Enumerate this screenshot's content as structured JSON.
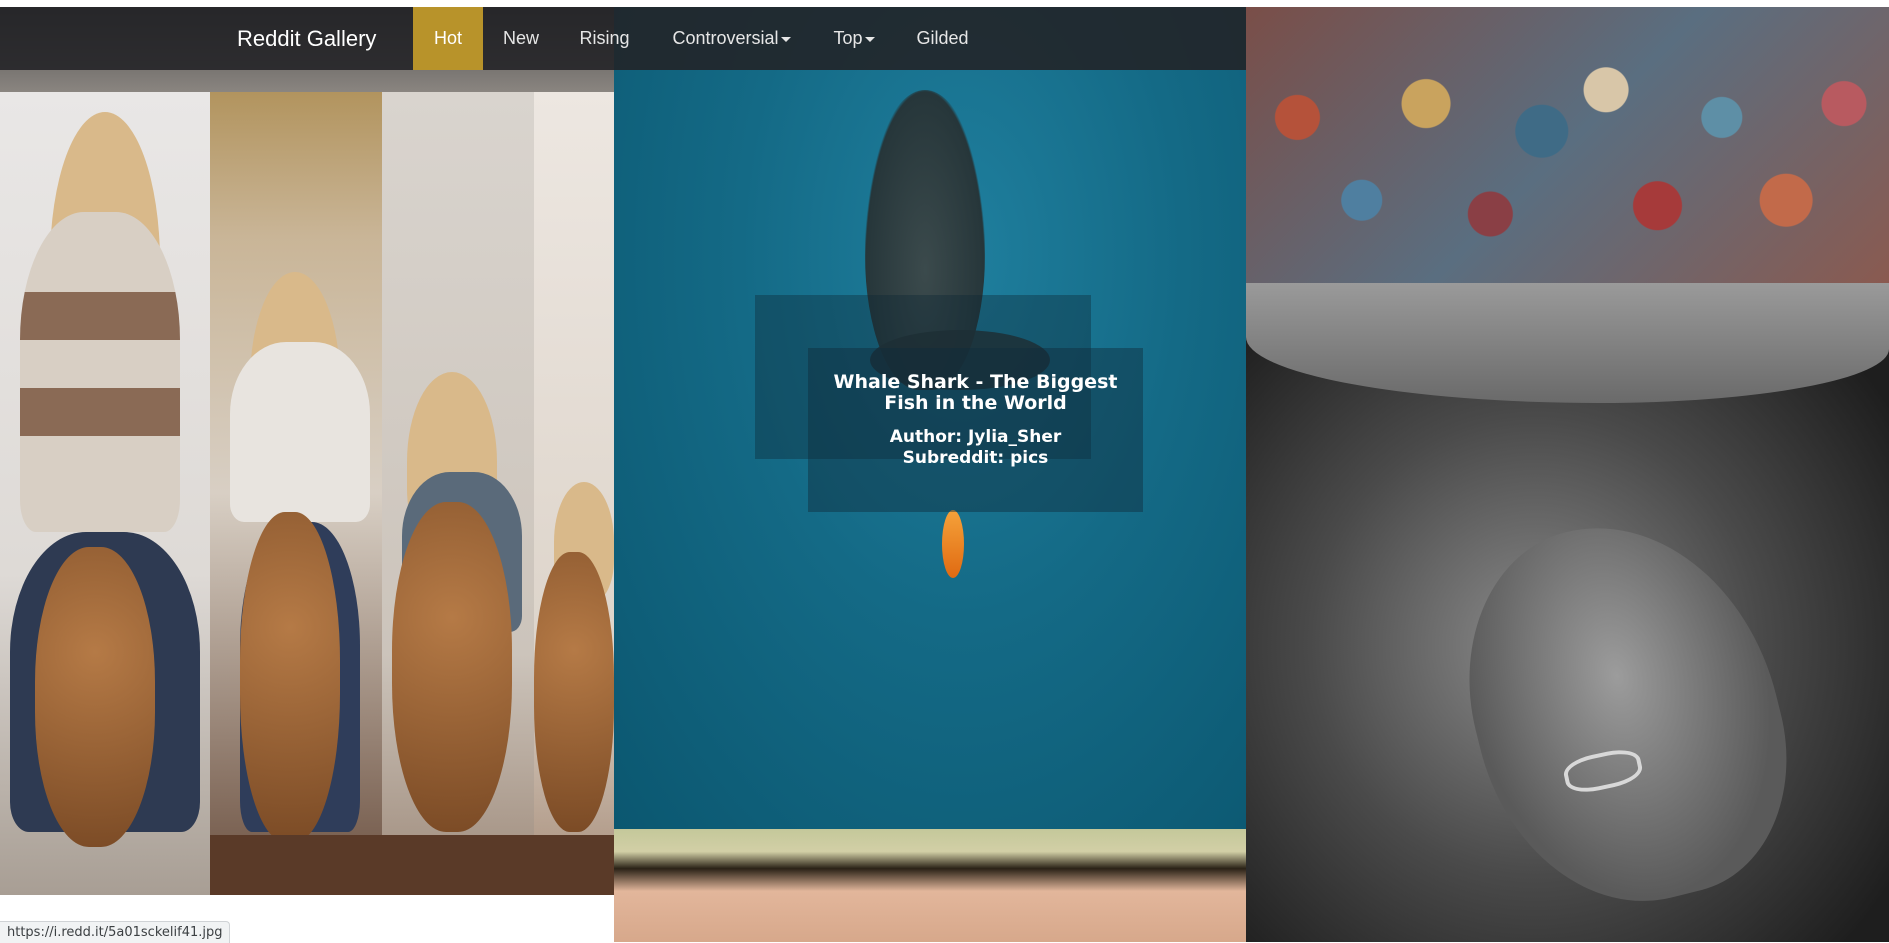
{
  "navbar": {
    "brand": "Reddit Gallery",
    "items": [
      {
        "label": "Hot",
        "active": true,
        "dropdown": false
      },
      {
        "label": "New",
        "active": false,
        "dropdown": false
      },
      {
        "label": "Rising",
        "active": false,
        "dropdown": false
      },
      {
        "label": "Controversial",
        "active": false,
        "dropdown": true
      },
      {
        "label": "Top",
        "active": false,
        "dropdown": true
      },
      {
        "label": "Gilded",
        "active": false,
        "dropdown": false
      }
    ],
    "active_color": "#b8932a",
    "caret_icon": "caret-down-icon"
  },
  "gallery": {
    "hovered_post": {
      "title": "Whale Shark - The Biggest Fish in the World",
      "author": "Author: Jylia_Sher",
      "subreddit": "Subreddit: pics"
    }
  },
  "statusbar": {
    "url": "https://i.redd.it/5a01sckelif41.jpg"
  }
}
